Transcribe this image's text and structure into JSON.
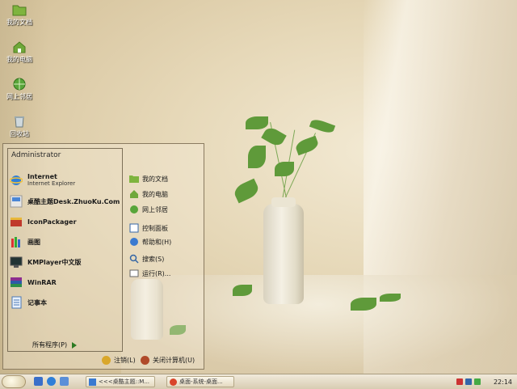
{
  "desktop_icons": [
    {
      "label": "我的文档",
      "icon": "folder-icon"
    },
    {
      "label": "我的电脑",
      "icon": "computer-icon"
    },
    {
      "label": "网上邻居",
      "icon": "network-icon"
    },
    {
      "label": "回收站",
      "icon": "recycle-bin-icon"
    }
  ],
  "start_menu": {
    "user_name": "Administrator",
    "pinned": [
      {
        "title": "Internet",
        "subtitle": "Internet Explorer",
        "icon": "internet-explorer-icon"
      },
      {
        "title": "桌酷主题Desk.ZhuoKu.Com",
        "subtitle": "",
        "icon": "zhuoku-icon"
      },
      {
        "title": "IconPackager",
        "subtitle": "",
        "icon": "iconpackager-icon"
      },
      {
        "title": "画图",
        "subtitle": "",
        "icon": "paint-icon"
      },
      {
        "title": "KMPlayer中文版",
        "subtitle": "",
        "icon": "kmplayer-icon"
      },
      {
        "title": "WinRAR",
        "subtitle": "",
        "icon": "winrar-icon"
      },
      {
        "title": "记事本",
        "subtitle": "",
        "icon": "notepad-icon"
      }
    ],
    "all_programs": "所有程序(P)",
    "right_items": [
      {
        "label": "我的文档",
        "icon": "folder-icon"
      },
      {
        "label": "我的电脑",
        "icon": "computer-icon"
      },
      {
        "label": "网上邻居",
        "icon": "network-icon"
      },
      {
        "label": "控制面板",
        "icon": "control-panel-icon"
      },
      {
        "label": "帮助和(H)",
        "icon": "help-icon"
      },
      {
        "label": "搜索(S)",
        "icon": "search-icon"
      },
      {
        "label": "运行(R)...",
        "icon": "run-icon"
      }
    ],
    "logoff": "注销(L)",
    "shutdown": "关闭计算机(U)"
  },
  "taskbar": {
    "buttons": [
      {
        "label": "<<<桌酷主题::M..."
      },
      {
        "label": "桌面-系统-桌面..."
      }
    ],
    "clock": "22:14"
  },
  "colors": {
    "desktop_bg": "#e6d8b8",
    "leaf_green": "#5f9a3a",
    "taskbar": "#e4d9c0"
  }
}
